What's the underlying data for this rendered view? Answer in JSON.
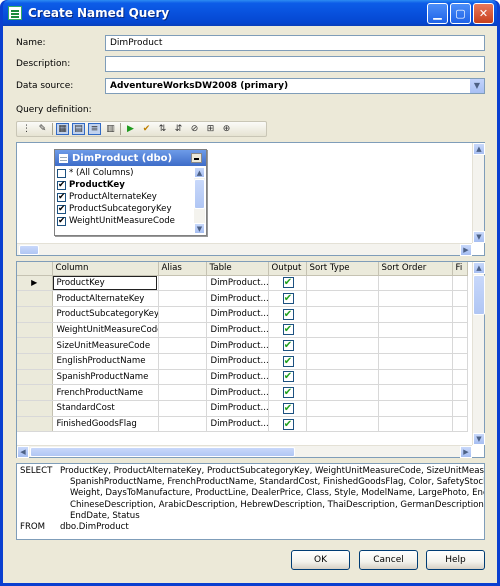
{
  "window": {
    "title": "Create Named Query"
  },
  "form": {
    "name_label": "Name:",
    "name_value": "DimProduct",
    "description_label": "Description:",
    "description_value": "",
    "datasource_label": "Data source:",
    "datasource_value": "AdventureWorksDW2008 (primary)",
    "query_label": "Query definition:"
  },
  "diagram": {
    "table_title": "DimProduct (dbo)",
    "columns": [
      {
        "label": "* (All Columns)",
        "checked": false,
        "bold": false
      },
      {
        "label": "ProductKey",
        "checked": true,
        "bold": true
      },
      {
        "label": "ProductAlternateKey",
        "checked": true,
        "bold": false
      },
      {
        "label": "ProductSubcategoryKey",
        "checked": true,
        "bold": false
      },
      {
        "label": "WeightUnitMeasureCode",
        "checked": true,
        "bold": false
      }
    ]
  },
  "grid": {
    "headers": [
      "Column",
      "Alias",
      "Table",
      "Output",
      "Sort Type",
      "Sort Order",
      "Fi"
    ],
    "rows": [
      {
        "column": "ProductKey",
        "alias": "",
        "table": "DimProduct...",
        "output": true
      },
      {
        "column": "ProductAlternateKey",
        "alias": "",
        "table": "DimProduct...",
        "output": true
      },
      {
        "column": "ProductSubcategoryKey",
        "alias": "",
        "table": "DimProduct...",
        "output": true
      },
      {
        "column": "WeightUnitMeasureCode",
        "alias": "",
        "table": "DimProduct...",
        "output": true
      },
      {
        "column": "SizeUnitMeasureCode",
        "alias": "",
        "table": "DimProduct...",
        "output": true
      },
      {
        "column": "EnglishProductName",
        "alias": "",
        "table": "DimProduct...",
        "output": true
      },
      {
        "column": "SpanishProductName",
        "alias": "",
        "table": "DimProduct...",
        "output": true
      },
      {
        "column": "FrenchProductName",
        "alias": "",
        "table": "DimProduct...",
        "output": true
      },
      {
        "column": "StandardCost",
        "alias": "",
        "table": "DimProduct...",
        "output": true
      },
      {
        "column": "FinishedGoodsFlag",
        "alias": "",
        "table": "DimProduct...",
        "output": true
      }
    ]
  },
  "sql": {
    "select_kw": "SELECT",
    "select_line1": "ProductKey, ProductAlternateKey, ProductSubcategoryKey, WeightUnitMeasureCode, SizeUnitMeasureCode, E",
    "select_line2": "SpanishProductName, FrenchProductName, StandardCost, FinishedGoodsFlag, Color, SafetyStockLevel, Re",
    "select_line3": "Weight, DaysToManufacture, ProductLine, DealerPrice, Class, Style, ModelName, LargePhoto, EnglishDescri",
    "select_line4": "ChineseDescription, ArabicDescription, HebrewDescription, ThaiDescription, GermanDescription, JapaneseDe",
    "select_line5": "EndDate, Status",
    "from_kw": "FROM",
    "from_value": "dbo.DimProduct"
  },
  "buttons": {
    "ok": "OK",
    "cancel": "Cancel",
    "help": "Help"
  },
  "icons": [
    "app-icon",
    "minimize-icon",
    "maximize-icon",
    "close-icon",
    "dropdown-arrow-icon",
    "check-icon",
    "row-pointer-icon"
  ]
}
